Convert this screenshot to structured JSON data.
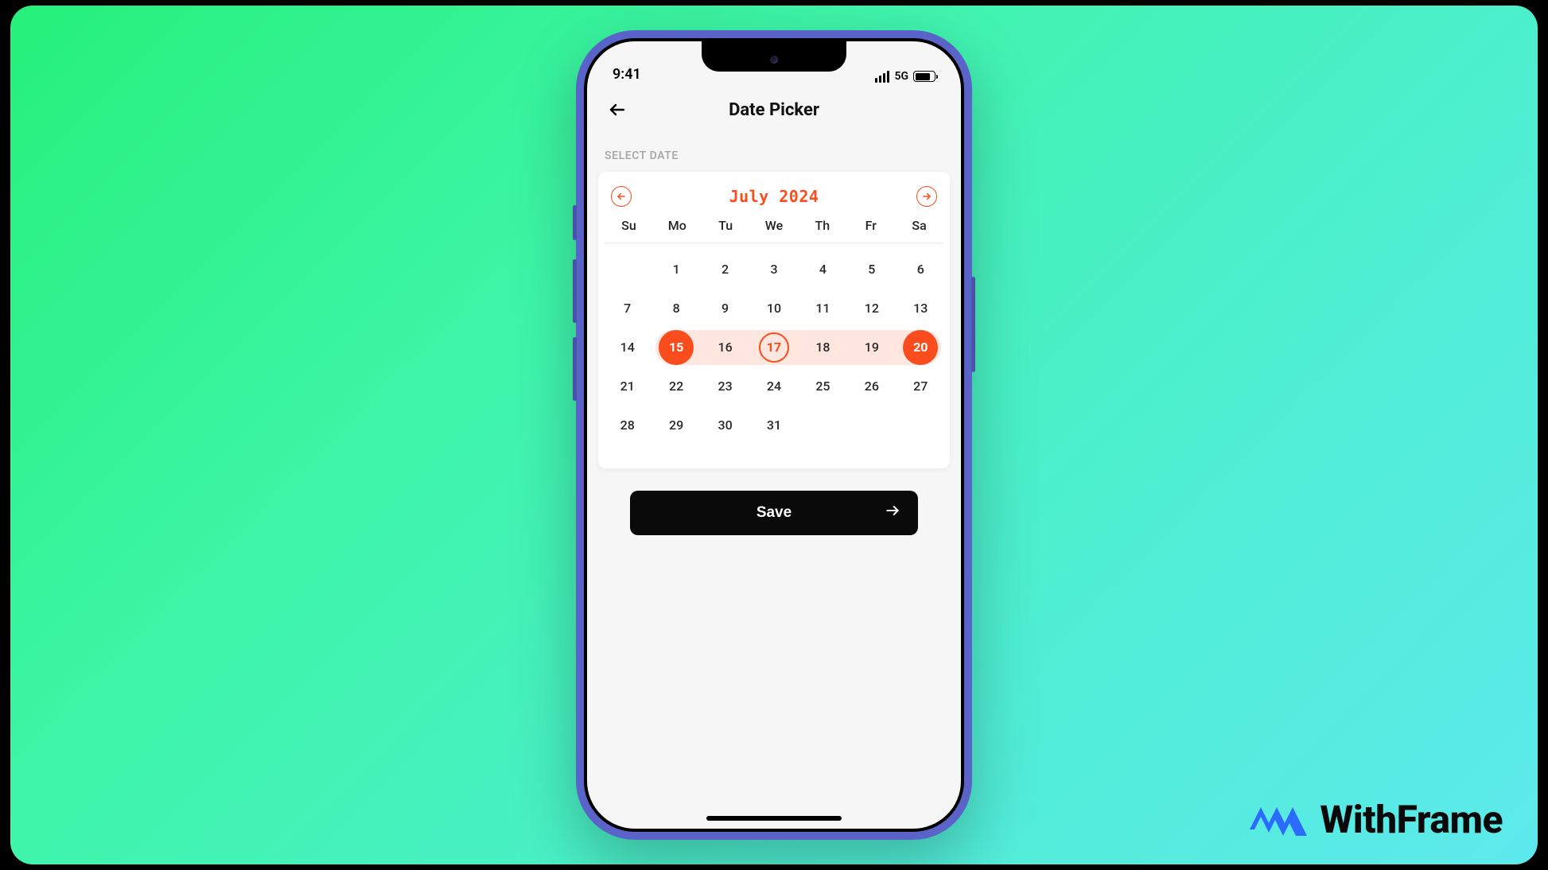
{
  "status_bar": {
    "time": "9:41",
    "network": "5G"
  },
  "header": {
    "title": "Date Picker"
  },
  "section_label": "SELECT DATE",
  "picker": {
    "month_label": "July 2024",
    "days_of_week": [
      "Su",
      "Mo",
      "Tu",
      "We",
      "Th",
      "Fr",
      "Sa"
    ],
    "weeks": [
      [
        null,
        1,
        2,
        3,
        4,
        5,
        6
      ],
      [
        7,
        8,
        9,
        10,
        11,
        12,
        13
      ],
      [
        14,
        15,
        16,
        17,
        18,
        19,
        20
      ],
      [
        21,
        22,
        23,
        24,
        25,
        26,
        27
      ],
      [
        28,
        29,
        30,
        31,
        null,
        null,
        null
      ]
    ],
    "range_start": 15,
    "range_end": 20,
    "today": 17
  },
  "actions": {
    "save_label": "Save"
  },
  "colors": {
    "accent": "#fb4c1e",
    "range_bg": "#ffe6df",
    "card_bg": "#ffffff",
    "screen_bg": "#f6f6f6"
  },
  "watermark": {
    "text": "WithFrame"
  }
}
